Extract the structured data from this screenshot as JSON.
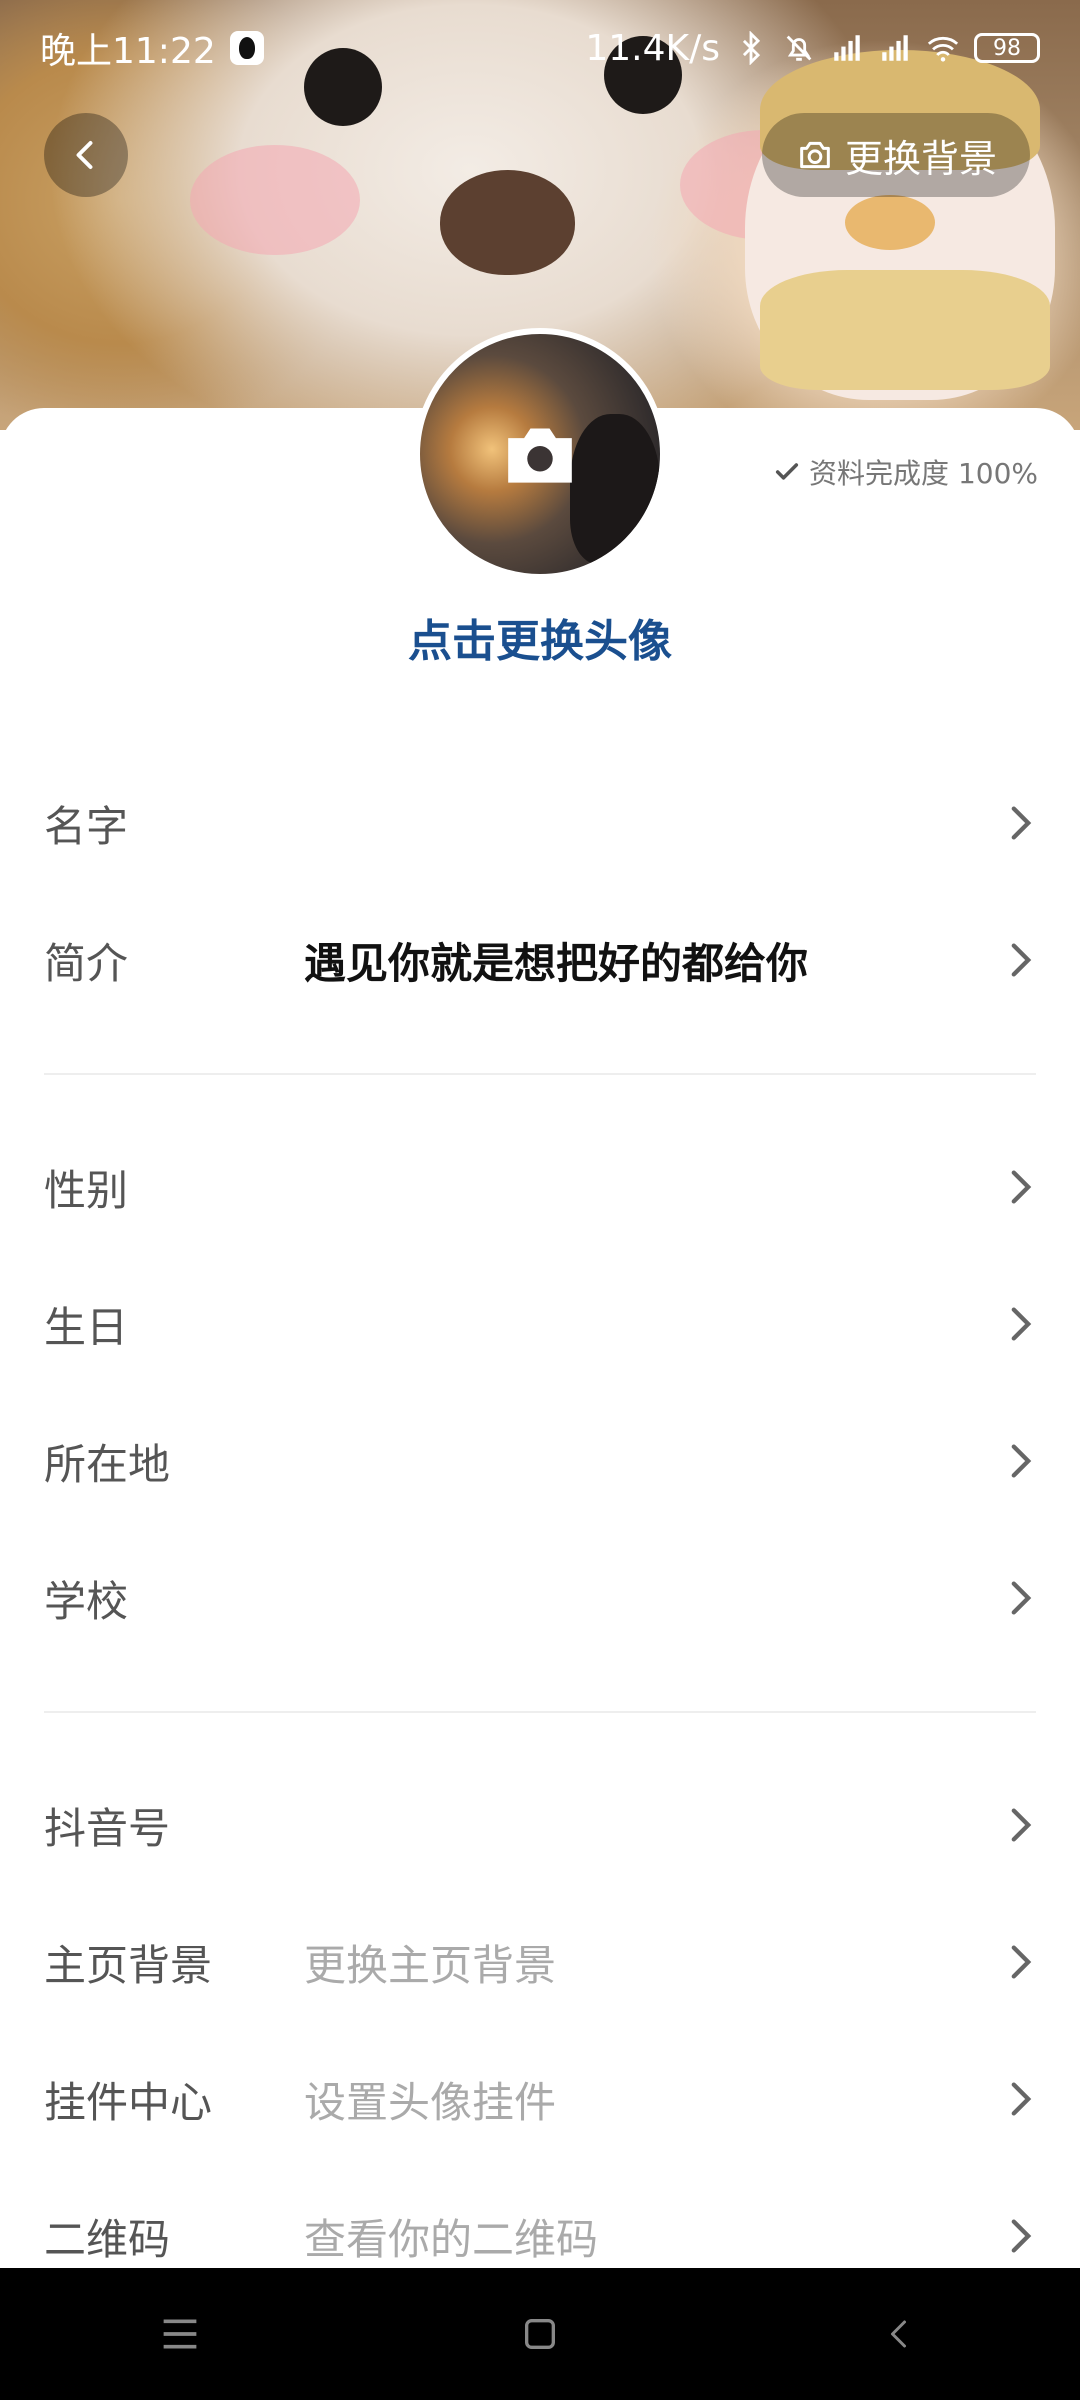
{
  "status_bar": {
    "time": "晚上11:22",
    "net_speed": "11.4K/s",
    "battery": "98"
  },
  "header": {
    "change_background_label": "更换背景"
  },
  "profile": {
    "completeness": "资料完成度 100%",
    "change_avatar_label": "点击更换头像"
  },
  "rows": [
    {
      "label": "名字",
      "value": ""
    },
    {
      "label": "简介",
      "value": "遇见你就是想把好的都给你"
    },
    {
      "label": "性别",
      "value": ""
    },
    {
      "label": "生日",
      "value": ""
    },
    {
      "label": "所在地",
      "value": ""
    },
    {
      "label": "学校",
      "value": ""
    },
    {
      "label": "抖音号",
      "value": ""
    },
    {
      "label": "主页背景",
      "value": "更换主页背景"
    },
    {
      "label": "挂件中心",
      "value": "设置头像挂件"
    },
    {
      "label": "二维码",
      "value": "查看你的二维码"
    }
  ],
  "icons": {
    "back": "chevron-left-icon",
    "camera": "camera-icon",
    "check": "check-icon",
    "chevron": "chevron-right-icon",
    "nav_menu": "menu-icon",
    "nav_home": "home-square-icon",
    "nav_back": "back-icon"
  },
  "colors": {
    "accent": "#1a4f8f",
    "muted_text": "#aaaaaa"
  }
}
